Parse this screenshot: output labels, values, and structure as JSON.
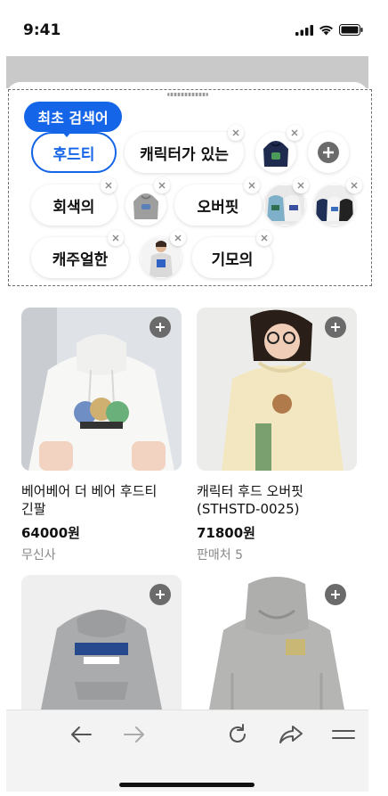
{
  "status": {
    "time": "9:41"
  },
  "recent": {
    "first_search_badge": "최초 검색어",
    "chips": [
      "후드티",
      "캐릭터가 있는",
      "회색의",
      "오버핏",
      "캐주얼한",
      "기모의"
    ]
  },
  "products": [
    {
      "title_line1": "베어베어 더 베어 후드티",
      "title_line2": "긴팔",
      "price": "64000원",
      "seller": "무신사"
    },
    {
      "title_line1": "캐릭터 후드 오버핏",
      "title_line2": "(STHSTD-0025)",
      "price": "71800원",
      "seller": "판매처 5"
    }
  ],
  "colors": {
    "accent": "#1565e8",
    "add_button": "#6b6b6b"
  },
  "icons": [
    "signal-icon",
    "wifi-icon",
    "battery-icon",
    "close-icon",
    "plus-icon",
    "back-arrow-icon",
    "forward-arrow-icon",
    "refresh-icon",
    "share-icon",
    "menu-icon"
  ]
}
